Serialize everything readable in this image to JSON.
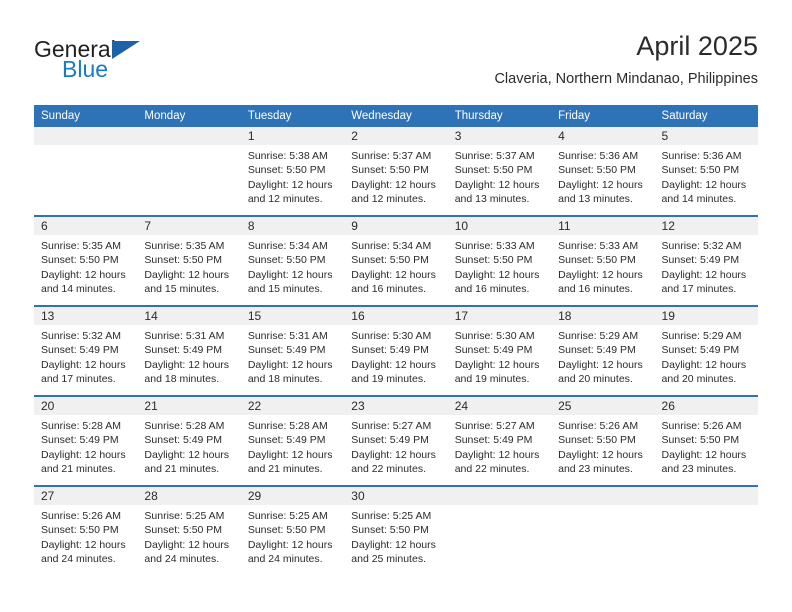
{
  "brand": {
    "name_part1": "General",
    "name_part2": "Blue",
    "triangle_color": "#1b62a8",
    "blue_color": "#1b7ac4"
  },
  "header": {
    "month_title": "April 2025",
    "location": "Claveria, Northern Mindanao, Philippines"
  },
  "theme": {
    "header_blue": "#2e73b8",
    "daynum_band": "#f0f0f0",
    "text": "#2b2b2b"
  },
  "calendar": {
    "weekday_headers": [
      "Sunday",
      "Monday",
      "Tuesday",
      "Wednesday",
      "Thursday",
      "Friday",
      "Saturday"
    ],
    "weeks": [
      [
        {
          "day": "",
          "empty": true
        },
        {
          "day": "",
          "empty": true
        },
        {
          "day": "1",
          "sunrise": "Sunrise: 5:38 AM",
          "sunset": "Sunset: 5:50 PM",
          "daylight": "Daylight: 12 hours and 12 minutes."
        },
        {
          "day": "2",
          "sunrise": "Sunrise: 5:37 AM",
          "sunset": "Sunset: 5:50 PM",
          "daylight": "Daylight: 12 hours and 12 minutes."
        },
        {
          "day": "3",
          "sunrise": "Sunrise: 5:37 AM",
          "sunset": "Sunset: 5:50 PM",
          "daylight": "Daylight: 12 hours and 13 minutes."
        },
        {
          "day": "4",
          "sunrise": "Sunrise: 5:36 AM",
          "sunset": "Sunset: 5:50 PM",
          "daylight": "Daylight: 12 hours and 13 minutes."
        },
        {
          "day": "5",
          "sunrise": "Sunrise: 5:36 AM",
          "sunset": "Sunset: 5:50 PM",
          "daylight": "Daylight: 12 hours and 14 minutes."
        }
      ],
      [
        {
          "day": "6",
          "sunrise": "Sunrise: 5:35 AM",
          "sunset": "Sunset: 5:50 PM",
          "daylight": "Daylight: 12 hours and 14 minutes."
        },
        {
          "day": "7",
          "sunrise": "Sunrise: 5:35 AM",
          "sunset": "Sunset: 5:50 PM",
          "daylight": "Daylight: 12 hours and 15 minutes."
        },
        {
          "day": "8",
          "sunrise": "Sunrise: 5:34 AM",
          "sunset": "Sunset: 5:50 PM",
          "daylight": "Daylight: 12 hours and 15 minutes."
        },
        {
          "day": "9",
          "sunrise": "Sunrise: 5:34 AM",
          "sunset": "Sunset: 5:50 PM",
          "daylight": "Daylight: 12 hours and 16 minutes."
        },
        {
          "day": "10",
          "sunrise": "Sunrise: 5:33 AM",
          "sunset": "Sunset: 5:50 PM",
          "daylight": "Daylight: 12 hours and 16 minutes."
        },
        {
          "day": "11",
          "sunrise": "Sunrise: 5:33 AM",
          "sunset": "Sunset: 5:50 PM",
          "daylight": "Daylight: 12 hours and 16 minutes."
        },
        {
          "day": "12",
          "sunrise": "Sunrise: 5:32 AM",
          "sunset": "Sunset: 5:49 PM",
          "daylight": "Daylight: 12 hours and 17 minutes."
        }
      ],
      [
        {
          "day": "13",
          "sunrise": "Sunrise: 5:32 AM",
          "sunset": "Sunset: 5:49 PM",
          "daylight": "Daylight: 12 hours and 17 minutes."
        },
        {
          "day": "14",
          "sunrise": "Sunrise: 5:31 AM",
          "sunset": "Sunset: 5:49 PM",
          "daylight": "Daylight: 12 hours and 18 minutes."
        },
        {
          "day": "15",
          "sunrise": "Sunrise: 5:31 AM",
          "sunset": "Sunset: 5:49 PM",
          "daylight": "Daylight: 12 hours and 18 minutes."
        },
        {
          "day": "16",
          "sunrise": "Sunrise: 5:30 AM",
          "sunset": "Sunset: 5:49 PM",
          "daylight": "Daylight: 12 hours and 19 minutes."
        },
        {
          "day": "17",
          "sunrise": "Sunrise: 5:30 AM",
          "sunset": "Sunset: 5:49 PM",
          "daylight": "Daylight: 12 hours and 19 minutes."
        },
        {
          "day": "18",
          "sunrise": "Sunrise: 5:29 AM",
          "sunset": "Sunset: 5:49 PM",
          "daylight": "Daylight: 12 hours and 20 minutes."
        },
        {
          "day": "19",
          "sunrise": "Sunrise: 5:29 AM",
          "sunset": "Sunset: 5:49 PM",
          "daylight": "Daylight: 12 hours and 20 minutes."
        }
      ],
      [
        {
          "day": "20",
          "sunrise": "Sunrise: 5:28 AM",
          "sunset": "Sunset: 5:49 PM",
          "daylight": "Daylight: 12 hours and 21 minutes."
        },
        {
          "day": "21",
          "sunrise": "Sunrise: 5:28 AM",
          "sunset": "Sunset: 5:49 PM",
          "daylight": "Daylight: 12 hours and 21 minutes."
        },
        {
          "day": "22",
          "sunrise": "Sunrise: 5:28 AM",
          "sunset": "Sunset: 5:49 PM",
          "daylight": "Daylight: 12 hours and 21 minutes."
        },
        {
          "day": "23",
          "sunrise": "Sunrise: 5:27 AM",
          "sunset": "Sunset: 5:49 PM",
          "daylight": "Daylight: 12 hours and 22 minutes."
        },
        {
          "day": "24",
          "sunrise": "Sunrise: 5:27 AM",
          "sunset": "Sunset: 5:49 PM",
          "daylight": "Daylight: 12 hours and 22 minutes."
        },
        {
          "day": "25",
          "sunrise": "Sunrise: 5:26 AM",
          "sunset": "Sunset: 5:50 PM",
          "daylight": "Daylight: 12 hours and 23 minutes."
        },
        {
          "day": "26",
          "sunrise": "Sunrise: 5:26 AM",
          "sunset": "Sunset: 5:50 PM",
          "daylight": "Daylight: 12 hours and 23 minutes."
        }
      ],
      [
        {
          "day": "27",
          "sunrise": "Sunrise: 5:26 AM",
          "sunset": "Sunset: 5:50 PM",
          "daylight": "Daylight: 12 hours and 24 minutes."
        },
        {
          "day": "28",
          "sunrise": "Sunrise: 5:25 AM",
          "sunset": "Sunset: 5:50 PM",
          "daylight": "Daylight: 12 hours and 24 minutes."
        },
        {
          "day": "29",
          "sunrise": "Sunrise: 5:25 AM",
          "sunset": "Sunset: 5:50 PM",
          "daylight": "Daylight: 12 hours and 24 minutes."
        },
        {
          "day": "30",
          "sunrise": "Sunrise: 5:25 AM",
          "sunset": "Sunset: 5:50 PM",
          "daylight": "Daylight: 12 hours and 25 minutes."
        },
        {
          "day": "",
          "empty": true
        },
        {
          "day": "",
          "empty": true
        },
        {
          "day": "",
          "empty": true
        }
      ]
    ]
  }
}
